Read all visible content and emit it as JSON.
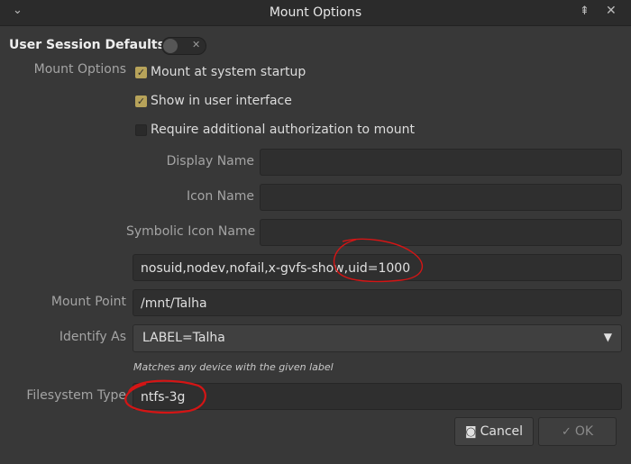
{
  "window": {
    "title": "Mount Options",
    "menu_icon": "chevron-down-icon",
    "pin_icon": "pin-icon",
    "close_icon": "close-icon"
  },
  "section": {
    "title": "User Session Defaults",
    "toggle_on": false
  },
  "labels": {
    "mount_options": "Mount Options",
    "display_name": "Display Name",
    "icon_name": "Icon Name",
    "symbolic_icon_name": "Symbolic Icon Name",
    "mount_point": "Mount Point",
    "identify_as": "Identify As",
    "filesystem_type": "Filesystem Type"
  },
  "checkboxes": [
    {
      "label": "Mount at system startup",
      "checked": true
    },
    {
      "label": "Show in user interface",
      "checked": true
    },
    {
      "label": "Require additional authorization to mount",
      "checked": false
    }
  ],
  "fields": {
    "display_name": "",
    "icon_name": "",
    "symbolic_icon_name": "",
    "options": "nosuid,nodev,nofail,x-gvfs-show,uid=1000",
    "mount_point": "/mnt/Talha",
    "identify_as": "LABEL=Talha",
    "identify_hint": "Matches any device with the given label",
    "filesystem_type": "ntfs-3g"
  },
  "buttons": {
    "cancel": "Cancel",
    "ok": "OK"
  },
  "colors": {
    "annotation": "#d41515",
    "checkbox_accent": "#b7a35a"
  }
}
